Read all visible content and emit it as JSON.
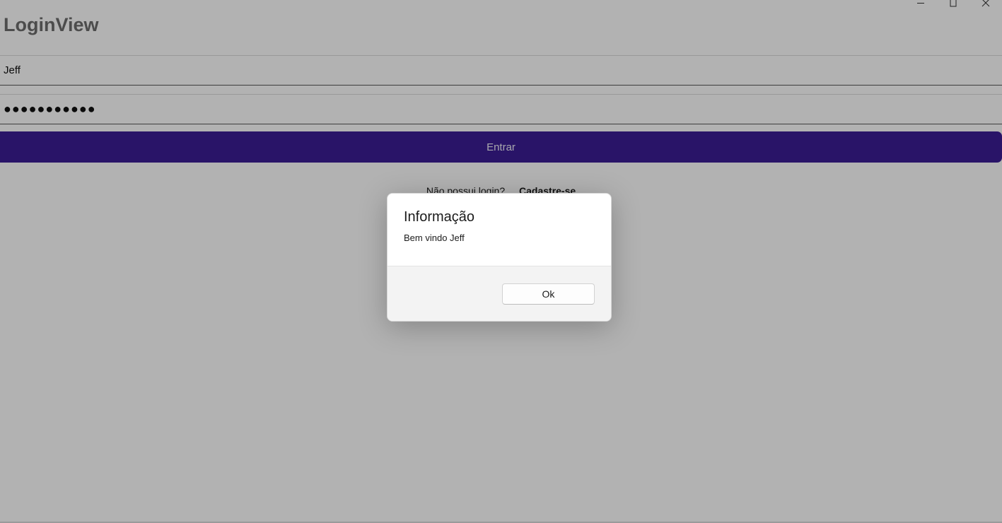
{
  "window": {
    "controls": [
      {
        "name": "minimize",
        "icon": "minimize-icon"
      },
      {
        "name": "maximize",
        "icon": "maximize-icon"
      },
      {
        "name": "close",
        "icon": "close-icon"
      }
    ]
  },
  "page": {
    "title": "LoginView"
  },
  "form": {
    "username_value": "Jeff",
    "password_value": "●●●●●●●●●●●",
    "submit_label": "Entrar",
    "submit_color": "#3b1e96",
    "no_login_text": "Não possui login?",
    "signup_link": "Cadastre-se"
  },
  "dialog": {
    "title": "Informação",
    "message": "Bem vindo Jeff",
    "ok_label": "Ok"
  }
}
